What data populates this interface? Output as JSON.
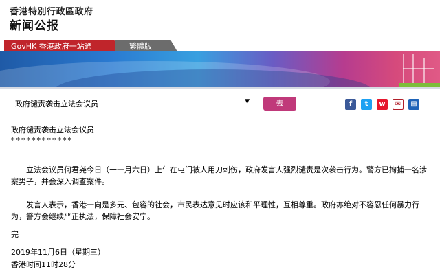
{
  "header": {
    "org": "香港特別行政區政府",
    "title": "新闻公报"
  },
  "tabs": [
    {
      "label": "GovHK 香港政府一站通"
    },
    {
      "label": "繁體版"
    }
  ],
  "navigator": {
    "selected": "政府谴责袭击立法会议员",
    "go_label": "去"
  },
  "share": [
    {
      "icon": "facebook-icon",
      "glyph": "f"
    },
    {
      "icon": "twitter-icon",
      "glyph": "t"
    },
    {
      "icon": "weibo-icon",
      "glyph": "w"
    },
    {
      "icon": "email-icon",
      "glyph": "✉"
    },
    {
      "icon": "print-icon",
      "glyph": "▤"
    }
  ],
  "article": {
    "title": "政府谴责袭击立法会议员",
    "stars": "************",
    "paragraph1": "立法会议员何君尧今日（十一月六日）上午在屯门被人用刀刺伤，政府发言人强烈谴责是次袭击行为。警方已拘捕一名涉案男子，并会深入调查案件。",
    "paragraph2": "发言人表示，香港一向是多元、包容的社会，市民表达意见时应该和平理性，互相尊重。政府亦绝对不容忍任何暴力行为，警方会继续严正执法，保障社会安宁。",
    "end": "完",
    "date": "2019年11月6日（星期三）",
    "time": "香港时间11时28分"
  },
  "colors": {
    "gov_tab": "#c0252b",
    "trad_tab": "#6c6c6c",
    "go_button": "#c0397a"
  }
}
